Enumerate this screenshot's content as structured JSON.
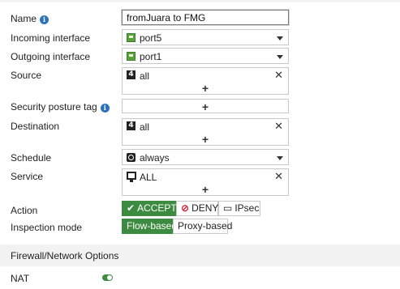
{
  "form": {
    "name": {
      "label": "Name",
      "value": "fromJuara to FMG"
    },
    "incoming": {
      "label": "Incoming interface",
      "value": "port5",
      "icon": "port-icon"
    },
    "outgoing": {
      "label": "Outgoing interface",
      "value": "port1",
      "icon": "port-icon"
    },
    "source": {
      "label": "Source",
      "value": "all",
      "icon": "address-icon",
      "icon_glyph": "4",
      "add": "+",
      "remove": "✕"
    },
    "posture": {
      "label": "Security posture tag",
      "add": "+"
    },
    "destination": {
      "label": "Destination",
      "value": "all",
      "icon": "address-icon",
      "icon_glyph": "4",
      "add": "+",
      "remove": "✕"
    },
    "schedule": {
      "label": "Schedule",
      "value": "always",
      "icon": "schedule-icon"
    },
    "service": {
      "label": "Service",
      "value": "ALL",
      "icon": "service-icon",
      "add": "+",
      "remove": "✕"
    },
    "action": {
      "label": "Action",
      "options": [
        "ACCEPT",
        "DENY",
        "IPsec"
      ],
      "selected": "ACCEPT"
    },
    "inspection": {
      "label": "Inspection mode",
      "options": [
        "Flow-based",
        "Proxy-based"
      ],
      "selected": "Flow-based"
    }
  },
  "section": {
    "title": "Firewall/Network Options"
  },
  "nat": {
    "label": "NAT",
    "enabled": true
  },
  "colors": {
    "accent": "#3d8b40",
    "info": "#2a73b8",
    "deny": "#d0021b"
  }
}
